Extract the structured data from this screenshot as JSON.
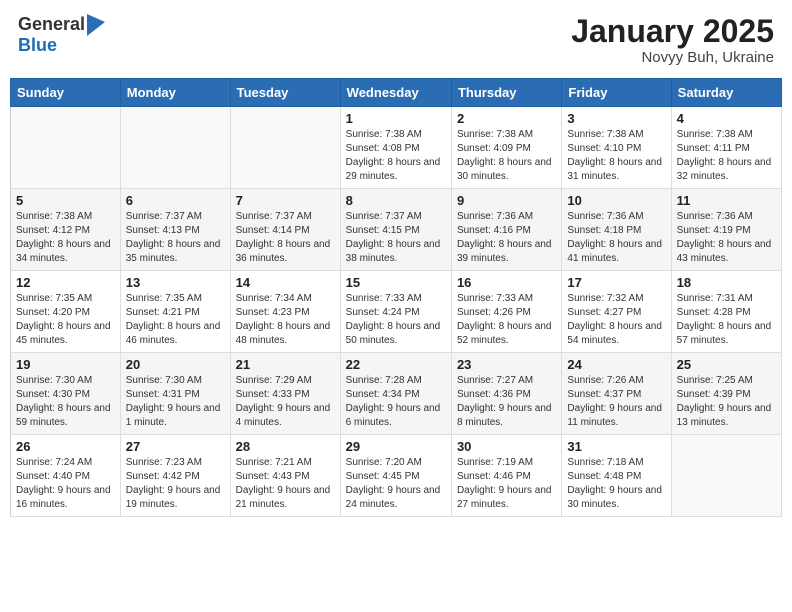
{
  "header": {
    "logo_general": "General",
    "logo_blue": "Blue",
    "month": "January 2025",
    "location": "Novyy Buh, Ukraine"
  },
  "weekdays": [
    "Sunday",
    "Monday",
    "Tuesday",
    "Wednesday",
    "Thursday",
    "Friday",
    "Saturday"
  ],
  "weeks": [
    [
      {
        "day": "",
        "info": ""
      },
      {
        "day": "",
        "info": ""
      },
      {
        "day": "",
        "info": ""
      },
      {
        "day": "1",
        "info": "Sunrise: 7:38 AM\nSunset: 4:08 PM\nDaylight: 8 hours and 29 minutes."
      },
      {
        "day": "2",
        "info": "Sunrise: 7:38 AM\nSunset: 4:09 PM\nDaylight: 8 hours and 30 minutes."
      },
      {
        "day": "3",
        "info": "Sunrise: 7:38 AM\nSunset: 4:10 PM\nDaylight: 8 hours and 31 minutes."
      },
      {
        "day": "4",
        "info": "Sunrise: 7:38 AM\nSunset: 4:11 PM\nDaylight: 8 hours and 32 minutes."
      }
    ],
    [
      {
        "day": "5",
        "info": "Sunrise: 7:38 AM\nSunset: 4:12 PM\nDaylight: 8 hours and 34 minutes."
      },
      {
        "day": "6",
        "info": "Sunrise: 7:37 AM\nSunset: 4:13 PM\nDaylight: 8 hours and 35 minutes."
      },
      {
        "day": "7",
        "info": "Sunrise: 7:37 AM\nSunset: 4:14 PM\nDaylight: 8 hours and 36 minutes."
      },
      {
        "day": "8",
        "info": "Sunrise: 7:37 AM\nSunset: 4:15 PM\nDaylight: 8 hours and 38 minutes."
      },
      {
        "day": "9",
        "info": "Sunrise: 7:36 AM\nSunset: 4:16 PM\nDaylight: 8 hours and 39 minutes."
      },
      {
        "day": "10",
        "info": "Sunrise: 7:36 AM\nSunset: 4:18 PM\nDaylight: 8 hours and 41 minutes."
      },
      {
        "day": "11",
        "info": "Sunrise: 7:36 AM\nSunset: 4:19 PM\nDaylight: 8 hours and 43 minutes."
      }
    ],
    [
      {
        "day": "12",
        "info": "Sunrise: 7:35 AM\nSunset: 4:20 PM\nDaylight: 8 hours and 45 minutes."
      },
      {
        "day": "13",
        "info": "Sunrise: 7:35 AM\nSunset: 4:21 PM\nDaylight: 8 hours and 46 minutes."
      },
      {
        "day": "14",
        "info": "Sunrise: 7:34 AM\nSunset: 4:23 PM\nDaylight: 8 hours and 48 minutes."
      },
      {
        "day": "15",
        "info": "Sunrise: 7:33 AM\nSunset: 4:24 PM\nDaylight: 8 hours and 50 minutes."
      },
      {
        "day": "16",
        "info": "Sunrise: 7:33 AM\nSunset: 4:26 PM\nDaylight: 8 hours and 52 minutes."
      },
      {
        "day": "17",
        "info": "Sunrise: 7:32 AM\nSunset: 4:27 PM\nDaylight: 8 hours and 54 minutes."
      },
      {
        "day": "18",
        "info": "Sunrise: 7:31 AM\nSunset: 4:28 PM\nDaylight: 8 hours and 57 minutes."
      }
    ],
    [
      {
        "day": "19",
        "info": "Sunrise: 7:30 AM\nSunset: 4:30 PM\nDaylight: 8 hours and 59 minutes."
      },
      {
        "day": "20",
        "info": "Sunrise: 7:30 AM\nSunset: 4:31 PM\nDaylight: 9 hours and 1 minute."
      },
      {
        "day": "21",
        "info": "Sunrise: 7:29 AM\nSunset: 4:33 PM\nDaylight: 9 hours and 4 minutes."
      },
      {
        "day": "22",
        "info": "Sunrise: 7:28 AM\nSunset: 4:34 PM\nDaylight: 9 hours and 6 minutes."
      },
      {
        "day": "23",
        "info": "Sunrise: 7:27 AM\nSunset: 4:36 PM\nDaylight: 9 hours and 8 minutes."
      },
      {
        "day": "24",
        "info": "Sunrise: 7:26 AM\nSunset: 4:37 PM\nDaylight: 9 hours and 11 minutes."
      },
      {
        "day": "25",
        "info": "Sunrise: 7:25 AM\nSunset: 4:39 PM\nDaylight: 9 hours and 13 minutes."
      }
    ],
    [
      {
        "day": "26",
        "info": "Sunrise: 7:24 AM\nSunset: 4:40 PM\nDaylight: 9 hours and 16 minutes."
      },
      {
        "day": "27",
        "info": "Sunrise: 7:23 AM\nSunset: 4:42 PM\nDaylight: 9 hours and 19 minutes."
      },
      {
        "day": "28",
        "info": "Sunrise: 7:21 AM\nSunset: 4:43 PM\nDaylight: 9 hours and 21 minutes."
      },
      {
        "day": "29",
        "info": "Sunrise: 7:20 AM\nSunset: 4:45 PM\nDaylight: 9 hours and 24 minutes."
      },
      {
        "day": "30",
        "info": "Sunrise: 7:19 AM\nSunset: 4:46 PM\nDaylight: 9 hours and 27 minutes."
      },
      {
        "day": "31",
        "info": "Sunrise: 7:18 AM\nSunset: 4:48 PM\nDaylight: 9 hours and 30 minutes."
      },
      {
        "day": "",
        "info": ""
      }
    ]
  ]
}
